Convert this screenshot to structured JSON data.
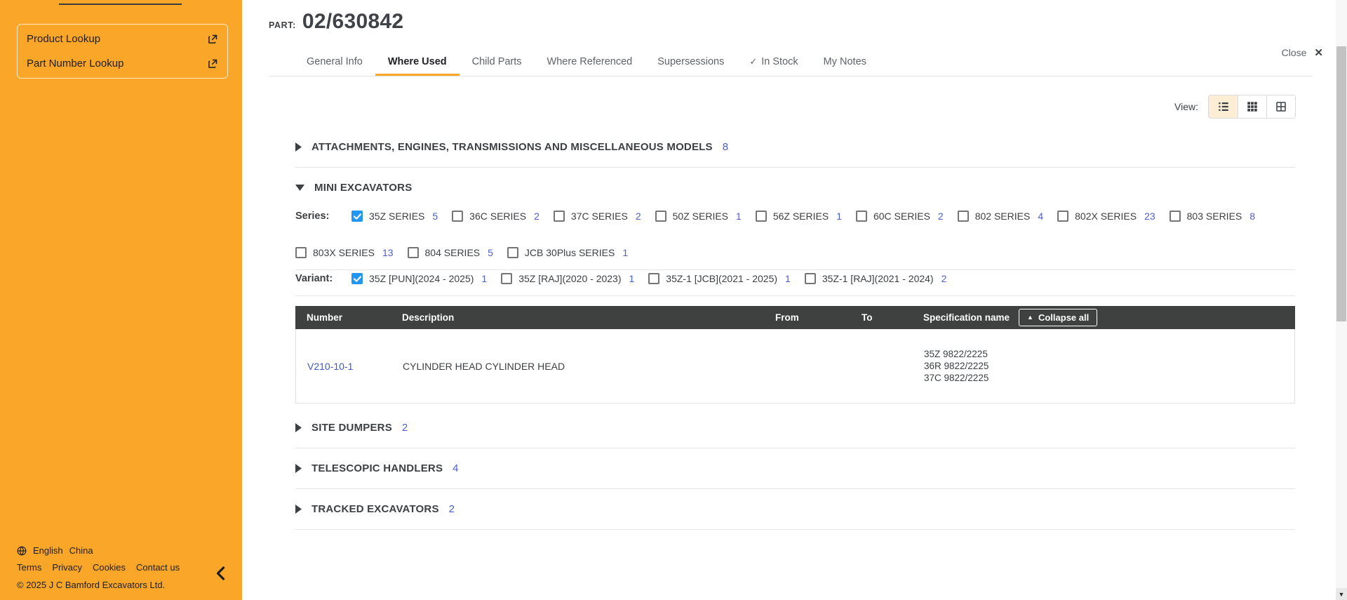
{
  "colors": {
    "accent_orange": "#F9A629",
    "count_blue": "#4A5FC6",
    "link_blue": "#3D5AC8",
    "checkbox_blue": "#2196F3",
    "header_dark": "#3F4040"
  },
  "icons": {
    "close": "✕",
    "check": "✓",
    "collapse_up": "▲",
    "scroll_down": "▼"
  },
  "sidebar": {
    "links": [
      {
        "label": "Product Lookup"
      },
      {
        "label": "Part Number Lookup"
      }
    ],
    "footer": {
      "language": "English",
      "region": "China",
      "links": [
        "Terms",
        "Privacy",
        "Cookies",
        "Contact us"
      ],
      "copyright": "© 2025 J C Bamford Excavators Ltd."
    }
  },
  "part": {
    "label": "PART:",
    "number": "02/630842"
  },
  "close_label": "Close",
  "tabs": [
    "General Info",
    "Where Used",
    "Child Parts",
    "Where Referenced",
    "Supersessions",
    "In Stock",
    "My Notes"
  ],
  "view": {
    "label": "View:"
  },
  "sections": {
    "attachments": {
      "title": "ATTACHMENTS, ENGINES, TRANSMISSIONS AND MISCELLANEOUS MODELS",
      "count": "8"
    },
    "mini": {
      "title": "MINI EXCAVATORS"
    },
    "site_dumpers": {
      "title": "SITE DUMPERS",
      "count": "2"
    },
    "telescopic": {
      "title": "TELESCOPIC HANDLERS",
      "count": "4"
    },
    "tracked": {
      "title": "TRACKED EXCAVATORS",
      "count": "2"
    }
  },
  "filters": {
    "series_label": "Series:",
    "series": [
      {
        "label": "35Z SERIES",
        "count": "5",
        "checked": true
      },
      {
        "label": "36C SERIES",
        "count": "2",
        "checked": false
      },
      {
        "label": "37C SERIES",
        "count": "2",
        "checked": false
      },
      {
        "label": "50Z SERIES",
        "count": "1",
        "checked": false
      },
      {
        "label": "56Z SERIES",
        "count": "1",
        "checked": false
      },
      {
        "label": "60C SERIES",
        "count": "2",
        "checked": false
      },
      {
        "label": "802 SERIES",
        "count": "4",
        "checked": false
      },
      {
        "label": "802X SERIES",
        "count": "23",
        "checked": false
      },
      {
        "label": "803 SERIES",
        "count": "8",
        "checked": false
      },
      {
        "label": "803X SERIES",
        "count": "13",
        "checked": false
      },
      {
        "label": "804 SERIES",
        "count": "5",
        "checked": false
      },
      {
        "label": "JCB 30Plus SERIES",
        "count": "1",
        "checked": false
      }
    ],
    "variant_label": "Variant:",
    "variants": [
      {
        "label": "35Z [PUN](2024 - 2025)",
        "count": "1",
        "checked": true
      },
      {
        "label": "35Z [RAJ](2020 - 2023)",
        "count": "1",
        "checked": false
      },
      {
        "label": "35Z-1 [JCB](2021 - 2025)",
        "count": "1",
        "checked": false
      },
      {
        "label": "35Z-1 [RAJ](2021 - 2024)",
        "count": "2",
        "checked": false
      }
    ]
  },
  "table": {
    "headers": {
      "number": "Number",
      "description": "Description",
      "from": "From",
      "to": "To",
      "spec": "Specification name"
    },
    "collapse_all": "Collapse all",
    "row": {
      "number": "V210-10-1",
      "description": "CYLINDER HEAD CYLINDER HEAD",
      "from": "",
      "to": "",
      "spec1": "35Z 9822/2225",
      "spec2": "36R 9822/2225",
      "spec3": "37C 9822/2225"
    }
  }
}
